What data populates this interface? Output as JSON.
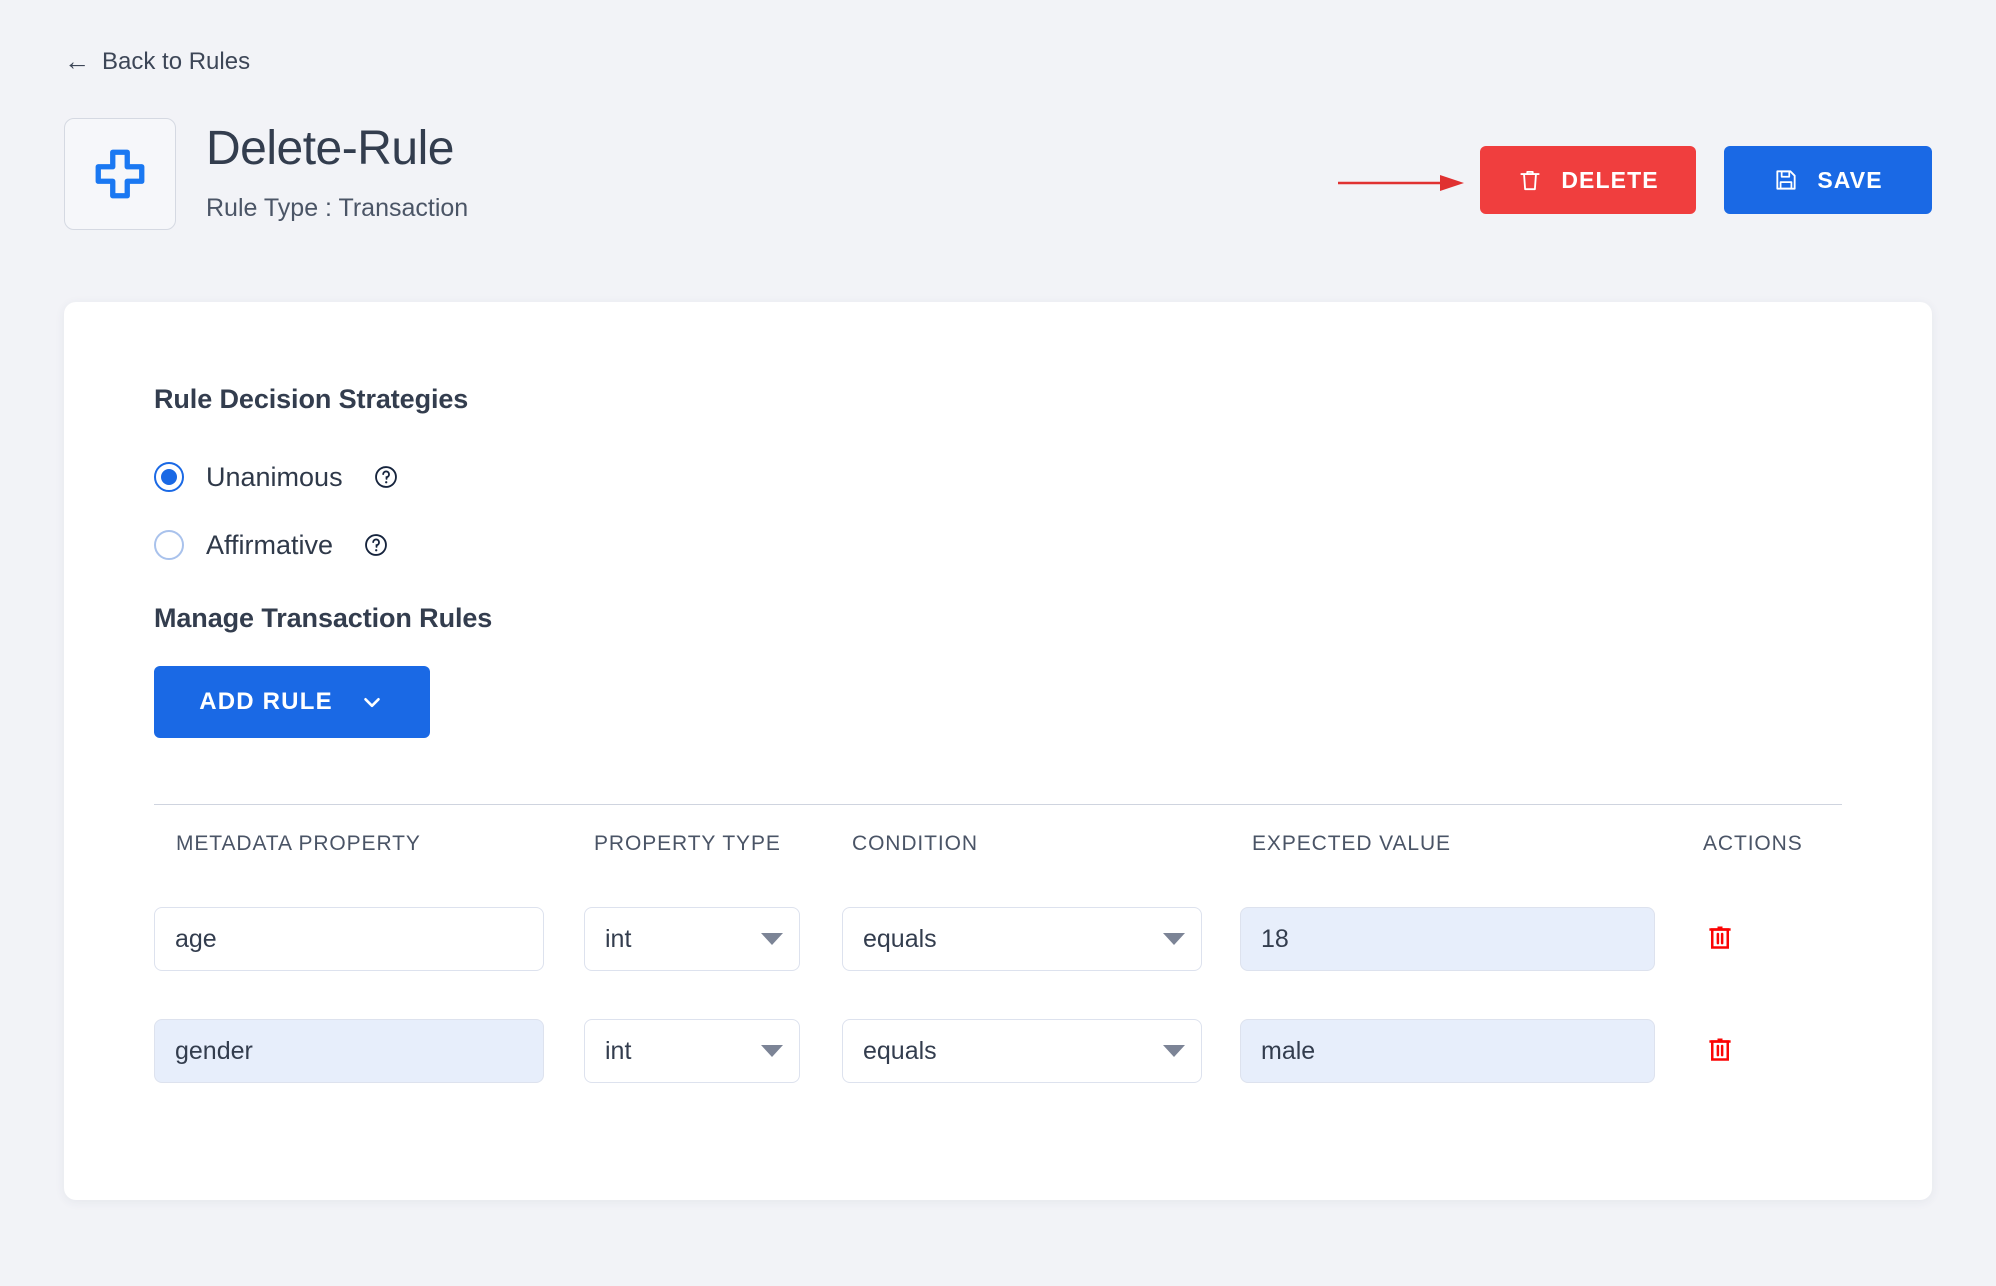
{
  "nav": {
    "back_label": "Back to Rules",
    "back_icon": "arrow-left-icon"
  },
  "header": {
    "logo_icon": "blue-plus-cross-icon",
    "title": "Delete-Rule",
    "subtitle": "Rule Type : Transaction",
    "actions": {
      "delete_label": "DELETE",
      "delete_icon": "trash-icon",
      "save_label": "SAVE",
      "save_icon": "floppy-disk-save-icon"
    },
    "annotation": {
      "arrow_icon": "red-pointer-arrow",
      "points_to": "DELETE"
    }
  },
  "main": {
    "strategies_heading": "Rule Decision Strategies",
    "strategies": [
      {
        "label": "Unanimous",
        "selected": true,
        "help_icon": "question-circle-icon"
      },
      {
        "label": "Affirmative",
        "selected": false,
        "help_icon": "question-circle-icon"
      }
    ],
    "manage_heading": "Manage Transaction Rules",
    "add_rule": {
      "label": "ADD RULE",
      "chevron_icon": "chevron-down-icon"
    },
    "table": {
      "headers": [
        "METADATA PROPERTY",
        "PROPERTY TYPE",
        "CONDITION",
        "EXPECTED VALUE",
        "ACTIONS"
      ],
      "rows": [
        {
          "metadata_property": "age",
          "metadata_property_highlighted": false,
          "property_type": "int",
          "condition": "equals",
          "expected_value": "18",
          "expected_value_highlighted": true,
          "delete_icon": "trash-icon"
        },
        {
          "metadata_property": "gender",
          "metadata_property_highlighted": true,
          "property_type": "int",
          "condition": "equals",
          "expected_value": "male",
          "expected_value_highlighted": true,
          "delete_icon": "trash-icon"
        }
      ]
    }
  },
  "colors": {
    "page_background": "#f2f3f7",
    "card_background": "#ffffff",
    "primary_blue": "#1a69e5",
    "danger_red": "#f03e3e",
    "text_dark": "#333d4e",
    "field_highlight": "#e7eefb",
    "field_border": "#dde2ee"
  }
}
